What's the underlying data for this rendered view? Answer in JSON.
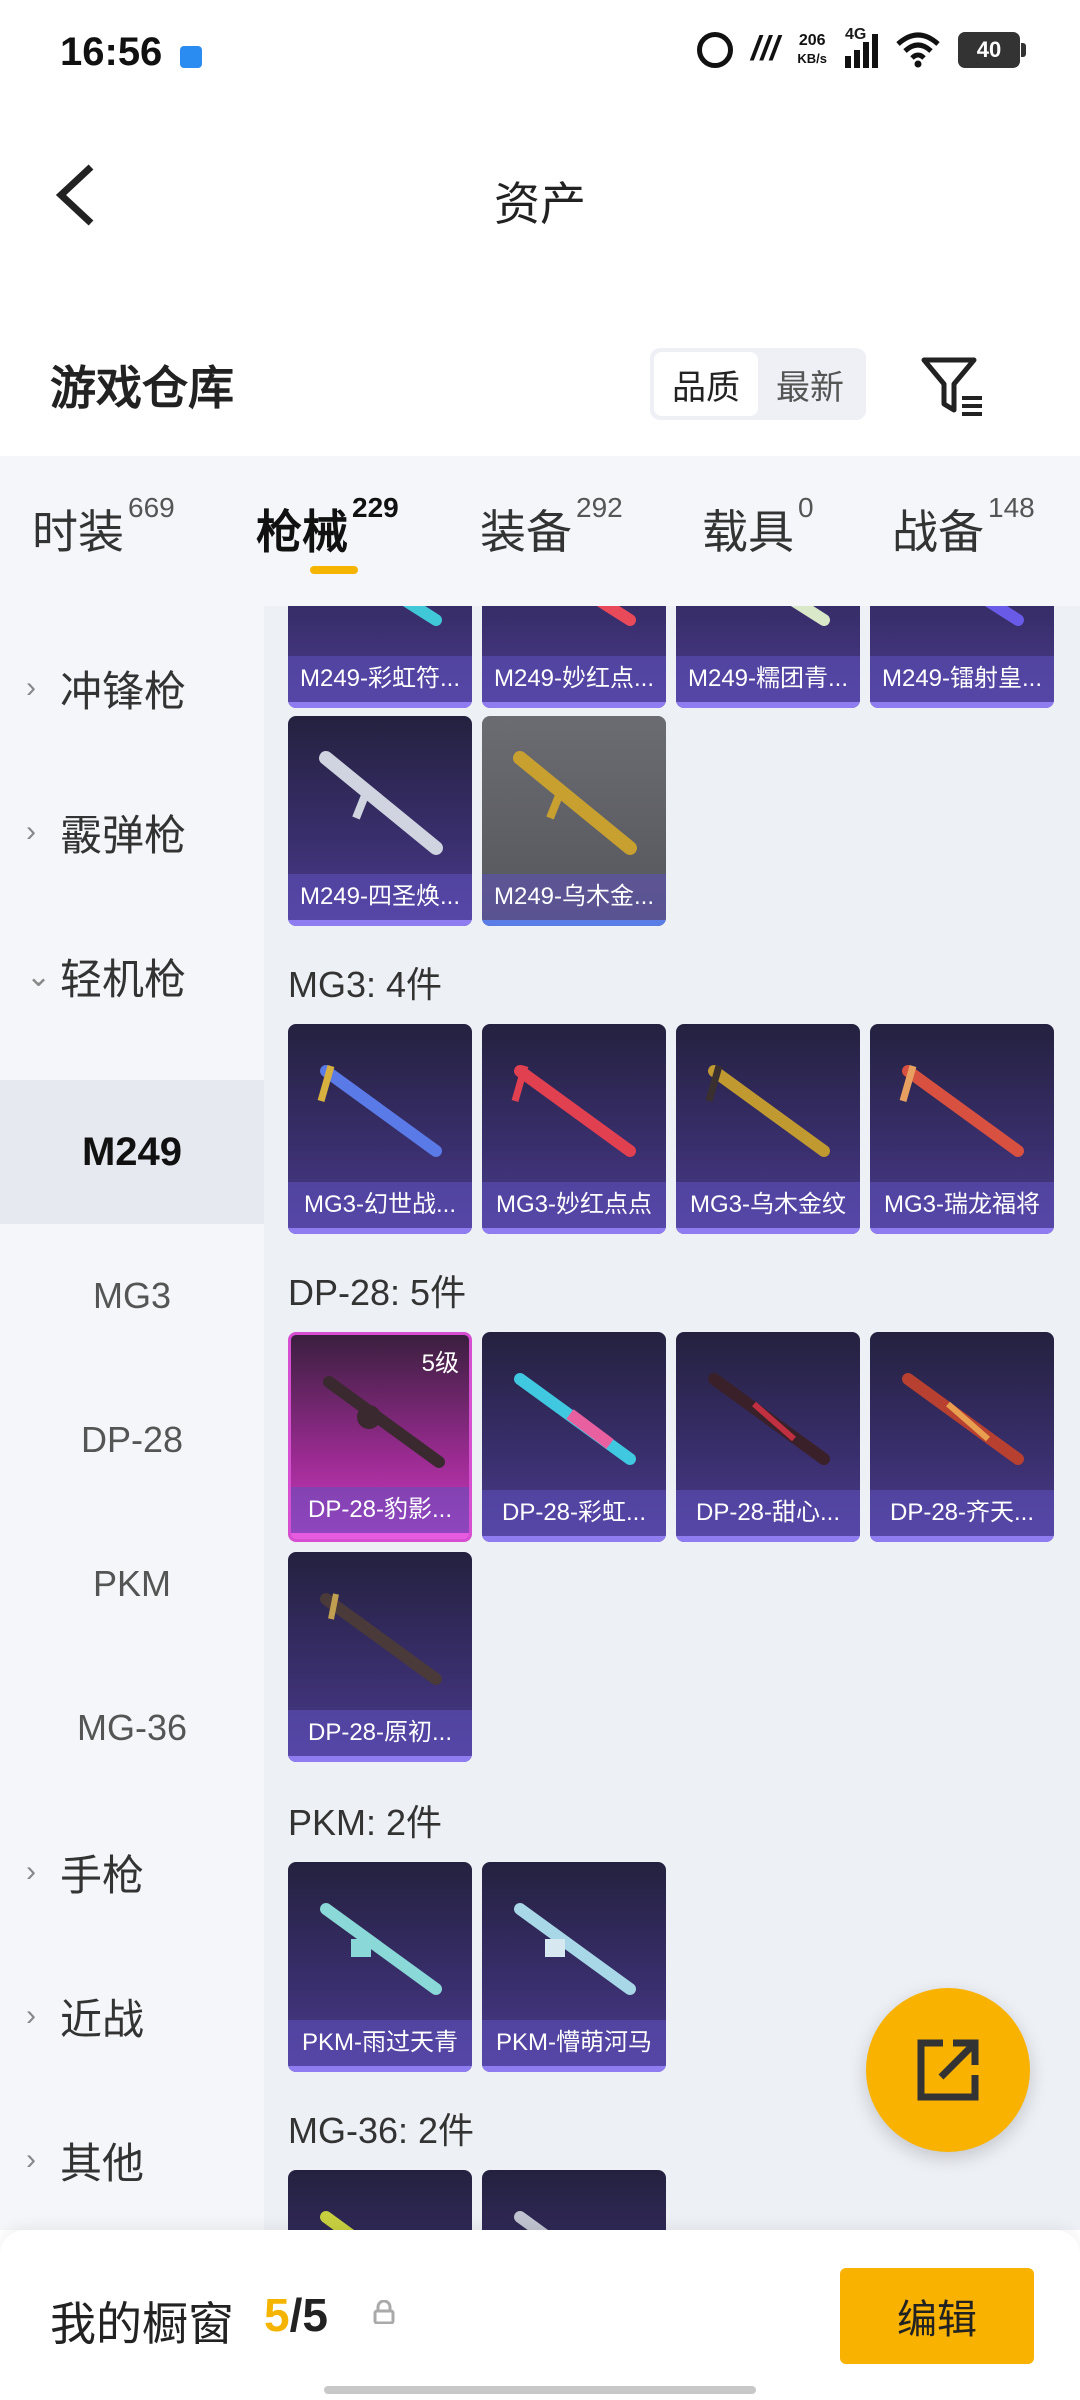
{
  "status_bar": {
    "time": "16:56",
    "network_speed_value": "206",
    "network_speed_unit": "KB/s",
    "network_type": "4G",
    "battery": "40"
  },
  "nav": {
    "title": "资产",
    "back_icon": "back-arrow-icon"
  },
  "warehouse": {
    "title": "游戏仓库",
    "sort_options": [
      "品质",
      "最新"
    ],
    "sort_selected": "品质",
    "filter_icon": "filter-icon"
  },
  "tabs": [
    {
      "label": "时装",
      "count": "669"
    },
    {
      "label": "枪械",
      "count": "229",
      "active": true
    },
    {
      "label": "装备",
      "count": "292"
    },
    {
      "label": "载具",
      "count": "0"
    },
    {
      "label": "战备",
      "count": "148"
    }
  ],
  "sidebar": {
    "items": [
      {
        "label": "冲锋枪",
        "type": "category",
        "expanded": false
      },
      {
        "label": "霰弹枪",
        "type": "category",
        "expanded": false
      },
      {
        "label": "轻机枪",
        "type": "category",
        "expanded": true
      },
      {
        "label": "M249",
        "type": "sub",
        "active": true
      },
      {
        "label": "MG3",
        "type": "sub"
      },
      {
        "label": "DP-28",
        "type": "sub"
      },
      {
        "label": "PKM",
        "type": "sub"
      },
      {
        "label": "MG-36",
        "type": "sub"
      },
      {
        "label": "手枪",
        "type": "category",
        "expanded": false
      },
      {
        "label": "近战",
        "type": "category",
        "expanded": false
      },
      {
        "label": "其他",
        "type": "category",
        "expanded": false
      }
    ]
  },
  "groups": [
    {
      "title": "",
      "items": [
        {
          "label": "M249-彩虹符..."
        },
        {
          "label": "M249-妙红点..."
        },
        {
          "label": "M249-糯团青..."
        },
        {
          "label": "M249-镭射皇..."
        },
        {
          "label": "M249-四圣焕..."
        },
        {
          "label": "M249-乌木金...",
          "style": "gray"
        }
      ]
    },
    {
      "title": "MG3: 4件",
      "items": [
        {
          "label": "MG3-幻世战..."
        },
        {
          "label": "MG3-妙红点点"
        },
        {
          "label": "MG3-乌木金纹"
        },
        {
          "label": "MG3-瑞龙福将"
        }
      ]
    },
    {
      "title": "DP-28: 5件",
      "items": [
        {
          "label": "DP-28-豹影...",
          "style": "pink",
          "level": "5级"
        },
        {
          "label": "DP-28-彩虹..."
        },
        {
          "label": "DP-28-甜心..."
        },
        {
          "label": "DP-28-齐天..."
        },
        {
          "label": "DP-28-原初..."
        }
      ]
    },
    {
      "title": "PKM: 2件",
      "items": [
        {
          "label": "PKM-雨过天青"
        },
        {
          "label": "PKM-懵萌河马"
        }
      ]
    },
    {
      "title": "MG-36: 2件",
      "items": [
        {
          "label": ""
        },
        {
          "label": ""
        }
      ]
    }
  ],
  "fab": {
    "icon": "share-external-icon"
  },
  "bottom_bar": {
    "title": "我的橱窗",
    "count_current": "5",
    "count_separator": "/",
    "count_total": "5",
    "lock_icon": "lock-icon",
    "edit_label": "编辑"
  },
  "colors": {
    "accent": "#f9b200",
    "card_purple": "#3a2f6e",
    "card_pink": "#cf3bc2",
    "card_gray": "#5f6066"
  }
}
